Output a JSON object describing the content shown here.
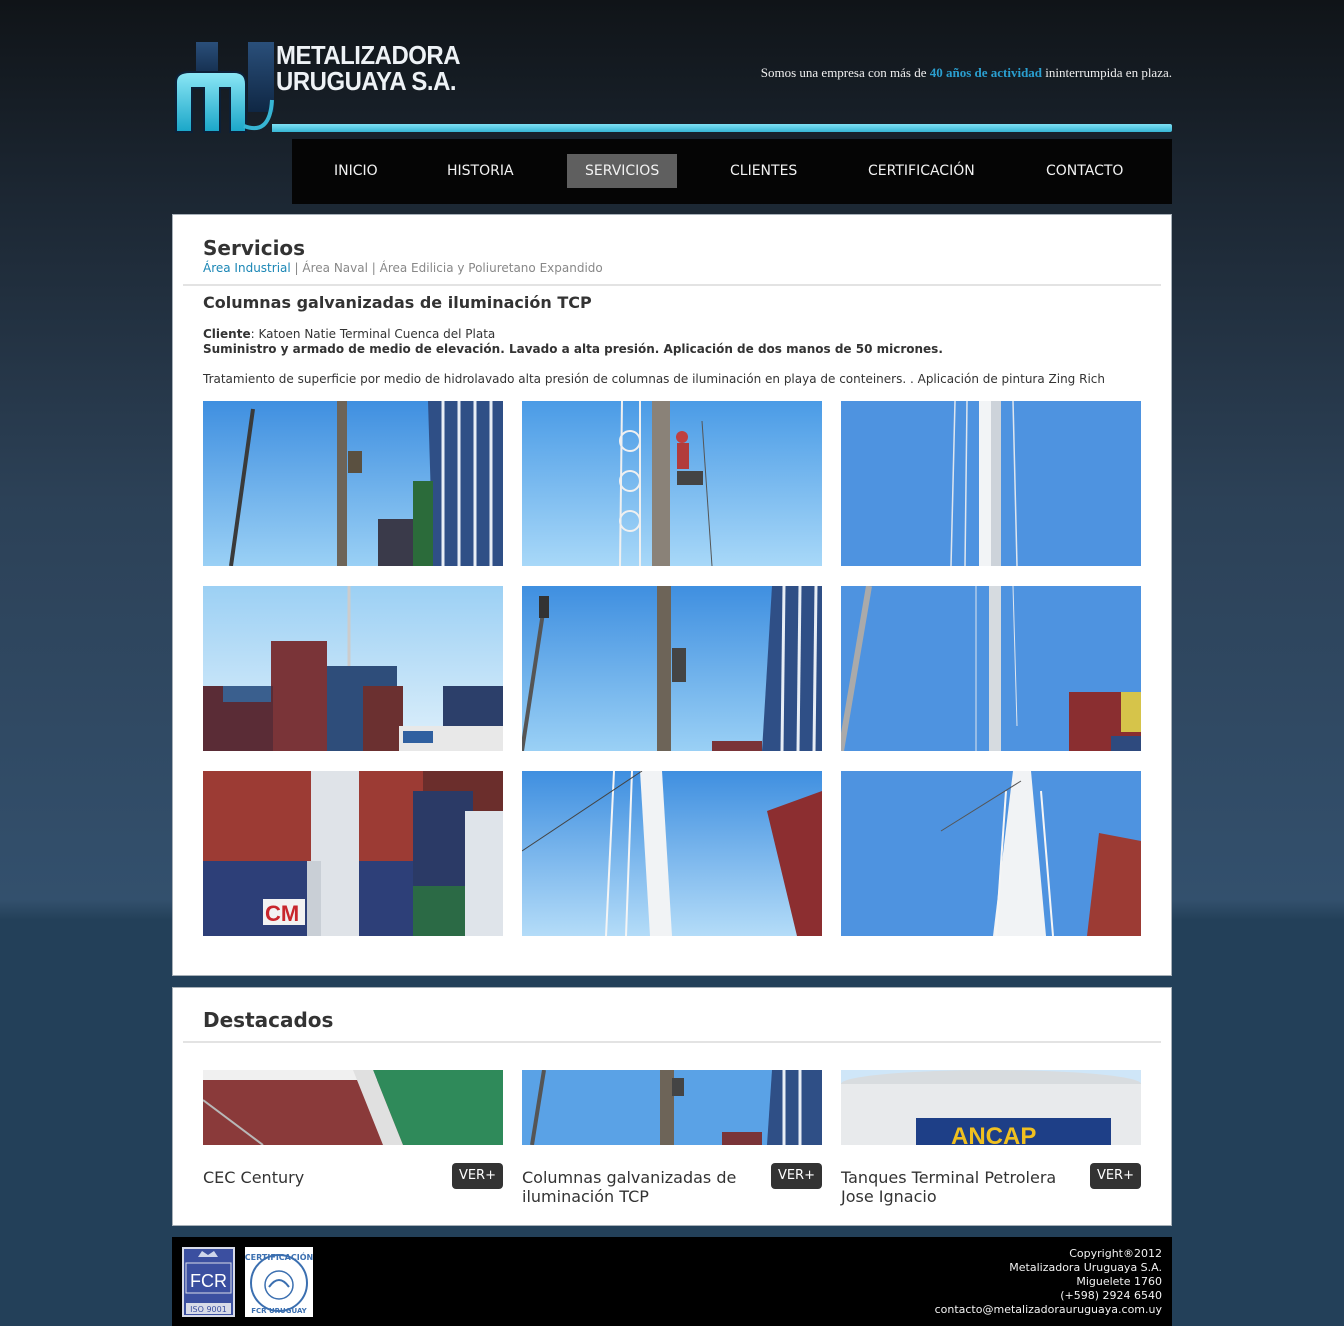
{
  "brand": {
    "name_line1": "METALIZADORA",
    "name_line2": "URUGUAYA S.A.",
    "tagline_pre": "Somos una empresa con más de ",
    "tagline_hl": "40 años de actividad",
    "tagline_post": " ininterrumpida en plaza.",
    "colors": {
      "accent": "#2a9fd0",
      "logo_line": "#37b5d3",
      "nav_bg": "#050505",
      "nav_active": "#5f5f5f"
    }
  },
  "nav": {
    "items": [
      {
        "label": "INICIO"
      },
      {
        "label": "HISTORIA"
      },
      {
        "label": "SERVICIOS",
        "active": true
      },
      {
        "label": "CLIENTES"
      },
      {
        "label": "CERTIFICACIÓN"
      },
      {
        "label": "CONTACTO"
      }
    ]
  },
  "main": {
    "title": "Servicios",
    "subnav": {
      "current": "Área Industrial",
      "sep": " | ",
      "item2": "Área Naval",
      "item3": "Área Edilicia y Poliuretano Expandido"
    },
    "article_title": "Columnas galvanizadas de iluminación TCP",
    "client_label": "Cliente",
    "client_value": ": Katoen Natie Terminal Cuenca del Plata",
    "supply": "Suministro y armado de medio de elevación. Lavado a alta presión. Aplicación de dos manos de 50 micrones.",
    "description": "Tratamiento de superficie por medio de hidrolavado alta presión de columnas de iluminación en playa de conteiners. . Aplicación de pintura Zing Rich",
    "gallery_icon": "photo-thumbnail"
  },
  "featured": {
    "title": "Destacados",
    "items": [
      {
        "title": "CEC Century",
        "button": "VER+"
      },
      {
        "title": "Columnas galvanizadas de iluminación TCP",
        "button": "VER+"
      },
      {
        "title": "Tanques Terminal Petrolera Jose Ignacio",
        "button": "VER+"
      }
    ]
  },
  "footer": {
    "badge1": "FCR",
    "badge1_sub": "ISO 9001",
    "badge2": "CERTIFICACIÓN",
    "badge2_sub": "FCR URUGUAY",
    "copyright": "Copyright®2012",
    "company": "Metalizadora Uruguaya S.A.",
    "address": "Miguelete 1760",
    "phone": "(+598) 2924 6540",
    "email": "contacto@metalizadorauruguaya.com.uy"
  }
}
